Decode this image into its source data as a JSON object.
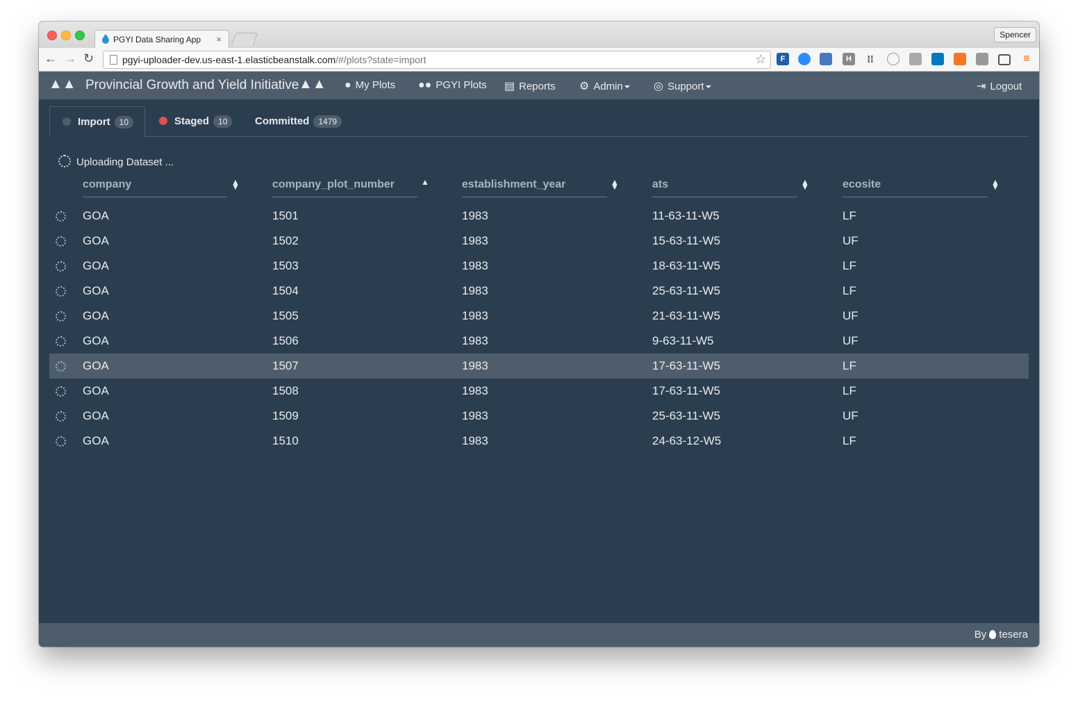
{
  "browser": {
    "tab_title": "PGYI Data Sharing App",
    "tab_close": "×",
    "profile": "Spencer",
    "url_host": "pgyi-uploader-dev.us-east-1.elasticbeanstalk.com",
    "url_path": "/#/plots?state=import"
  },
  "navbar": {
    "brand": "Provincial Growth and Yield Initiative",
    "items": [
      {
        "label": "My Plots",
        "icon": "user-icon"
      },
      {
        "label": "PGYI Plots",
        "icon": "users-icon"
      },
      {
        "label": "Reports",
        "icon": "file-icon"
      },
      {
        "label": "Admin",
        "icon": "gears-icon"
      },
      {
        "label": "Support",
        "icon": "lifebuoy-icon"
      }
    ],
    "logout": "Logout"
  },
  "state_tabs": [
    {
      "label": "Import",
      "count": "10",
      "dot_color": "#4e5d6c"
    },
    {
      "label": "Staged",
      "count": "10",
      "dot_color": "#d9534f"
    },
    {
      "label": "Committed",
      "count": "1479"
    }
  ],
  "status_text": "Uploading Dataset ...",
  "table": {
    "columns": [
      "company",
      "company_plot_number",
      "establishment_year",
      "ats",
      "ecosite"
    ],
    "sorted_column": "company_plot_number",
    "sort_direction": "ascending",
    "highlighted_row": 7,
    "rows": [
      [
        "GOA",
        "1501",
        "1983",
        "11-63-11-W5",
        "LF"
      ],
      [
        "GOA",
        "1502",
        "1983",
        "15-63-11-W5",
        "UF"
      ],
      [
        "GOA",
        "1503",
        "1983",
        "18-63-11-W5",
        "LF"
      ],
      [
        "GOA",
        "1504",
        "1983",
        "25-63-11-W5",
        "LF"
      ],
      [
        "GOA",
        "1505",
        "1983",
        "21-63-11-W5",
        "UF"
      ],
      [
        "GOA",
        "1506",
        "1983",
        "9-63-11-W5",
        "UF"
      ],
      [
        "GOA",
        "1507",
        "1983",
        "17-63-11-W5",
        "LF"
      ],
      [
        "GOA",
        "1508",
        "1983",
        "17-63-11-W5",
        "LF"
      ],
      [
        "GOA",
        "1509",
        "1983",
        "25-63-11-W5",
        "UF"
      ],
      [
        "GOA",
        "1510",
        "1983",
        "24-63-12-W5",
        "LF"
      ]
    ]
  },
  "footer": {
    "by": "By",
    "brand": "tesera"
  }
}
